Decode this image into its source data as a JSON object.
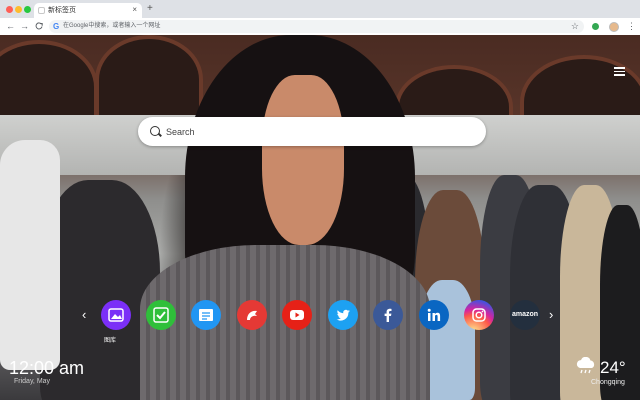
{
  "browser": {
    "tab_title": "新标签页",
    "tab_close": "×",
    "new_tab": "+",
    "back": "←",
    "forward": "→",
    "reload": "C",
    "omnibox_g": "G",
    "omnibox_placeholder": "在Google中搜索，或者输入一个网址",
    "star": "☆",
    "menu": "⋮",
    "window_controls": [
      "#ff5f57",
      "#febc2e",
      "#28c840"
    ],
    "extension_color": "#34a853"
  },
  "search": {
    "placeholder": "Search"
  },
  "shortcuts": {
    "label": "图库",
    "prev": "‹",
    "next": "›",
    "items": [
      {
        "name": "gallery",
        "color": "#7b2ff7"
      },
      {
        "name": "checklist",
        "color": "#2fbf3a"
      },
      {
        "name": "notes",
        "color": "#2196f3"
      },
      {
        "name": "game",
        "color": "#e53935"
      },
      {
        "name": "youtube",
        "color": "#e62117"
      },
      {
        "name": "twitter",
        "color": "#1da1f2"
      },
      {
        "name": "facebook",
        "color": "#3b5998"
      },
      {
        "name": "linkedin",
        "color": "#0a66c2"
      },
      {
        "name": "instagram",
        "color": "#c13584"
      },
      {
        "name": "amazon",
        "color": "#232f3e",
        "text": "amazon"
      }
    ]
  },
  "clock": {
    "time": "12:00 am",
    "date": "Friday, May"
  },
  "weather": {
    "temp": "24°",
    "city": "Chongqing",
    "icon": "cloud-rain-icon"
  }
}
